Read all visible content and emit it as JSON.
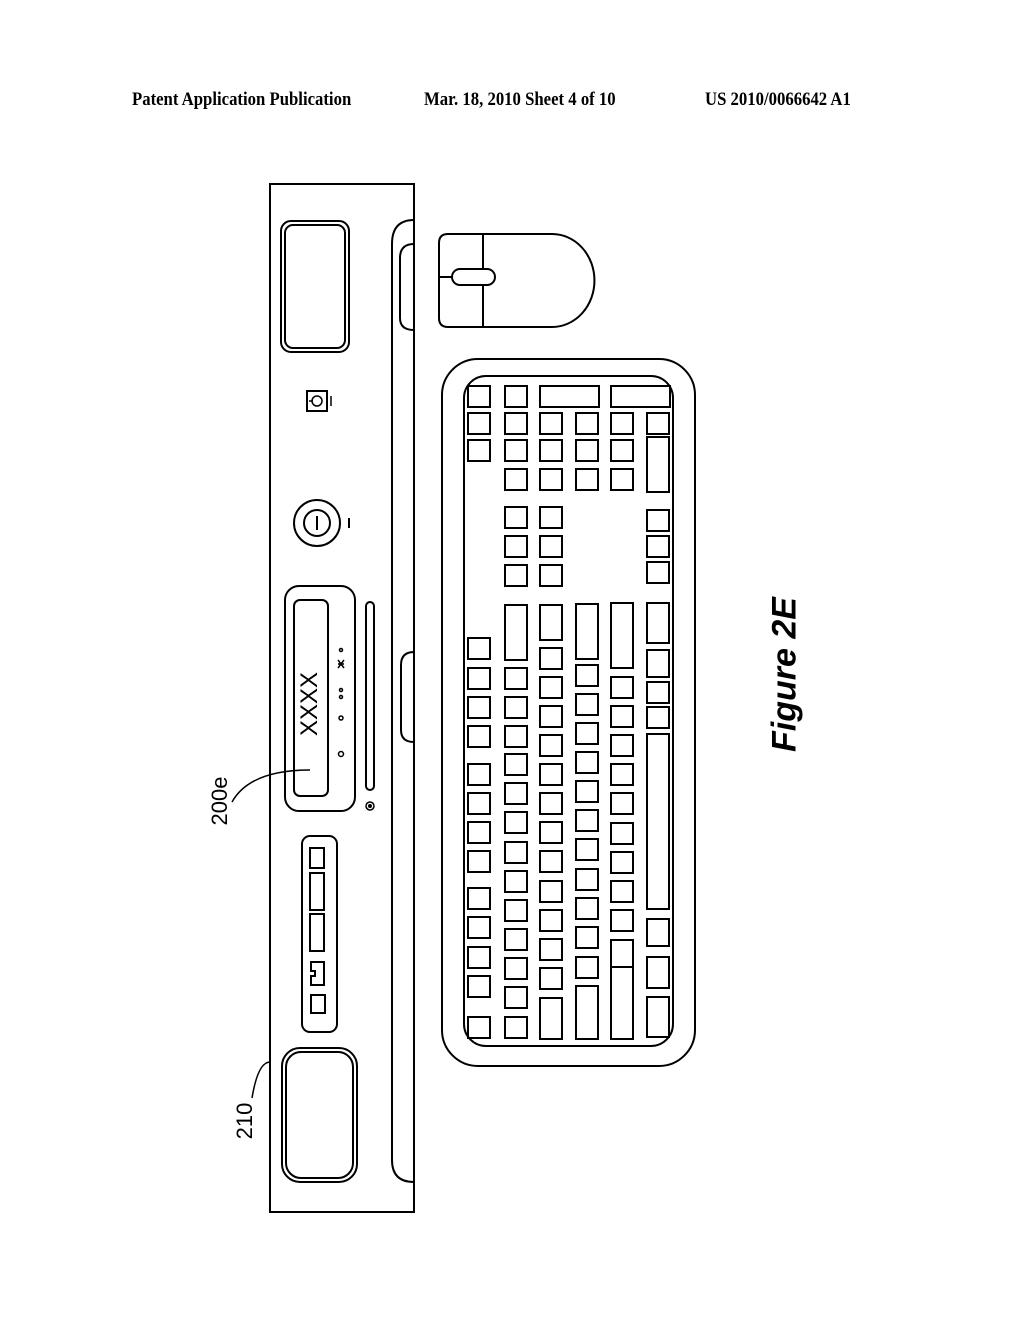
{
  "header": {
    "left": "Patent Application Publication",
    "middle": "Mar. 18, 2010  Sheet 4 of 10",
    "right": "US 2010/0066642 A1"
  },
  "figure": {
    "caption": "Figure 2E",
    "reference_labels": {
      "display_panel": "200e",
      "console": "210"
    },
    "display_text": "XXXX",
    "components": [
      "console-unit",
      "display-panel",
      "power-button",
      "standby-button",
      "media-slot",
      "card-reader-ports",
      "mouse",
      "keyboard"
    ]
  }
}
